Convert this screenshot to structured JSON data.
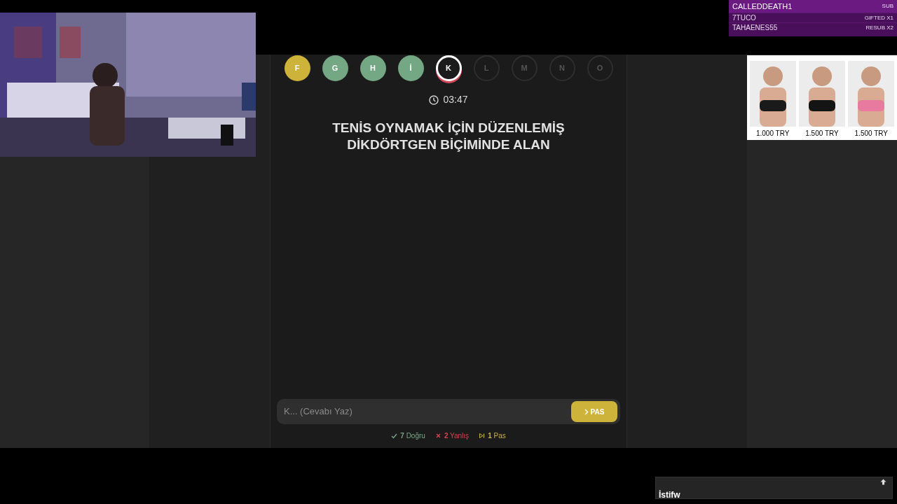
{
  "subs": [
    {
      "name": "CALLEDDEATH1",
      "event": "SUB",
      "highlight": true
    },
    {
      "name": "7TUCO",
      "event": "GIFTED X1",
      "highlight": false
    },
    {
      "name": "TAHAENES55",
      "event": "RESUB X2",
      "highlight": false
    }
  ],
  "letters": [
    {
      "letter": "F",
      "kind": "pass"
    },
    {
      "letter": "G",
      "kind": "correct"
    },
    {
      "letter": "H",
      "kind": "correct"
    },
    {
      "letter": "İ",
      "kind": "correct"
    },
    {
      "letter": "K",
      "kind": "current"
    },
    {
      "letter": "L",
      "kind": "pending"
    },
    {
      "letter": "M",
      "kind": "pending"
    },
    {
      "letter": "N",
      "kind": "pending"
    },
    {
      "letter": "O",
      "kind": "pending"
    }
  ],
  "timer": "03:47",
  "question": "TENİS OYNAMAK İÇİN DÜZENLEMİŞ DİKDÖRTGEN BİÇİMİNDE ALAN",
  "answer": {
    "placeholder": "K... (Cevabı Yaz)",
    "button": "PAS"
  },
  "stats": [
    {
      "kind": "correct",
      "count": "7",
      "label": "Doğru"
    },
    {
      "kind": "wrong",
      "count": "2",
      "label": "Yanlış"
    },
    {
      "kind": "pass",
      "count": "1",
      "label": "Pas"
    }
  ],
  "products": [
    {
      "price": "1.000 TRY"
    },
    {
      "price": "1.500 TRY"
    },
    {
      "price": "1.500 TRY"
    }
  ],
  "chat": {
    "message": "İstifw"
  }
}
